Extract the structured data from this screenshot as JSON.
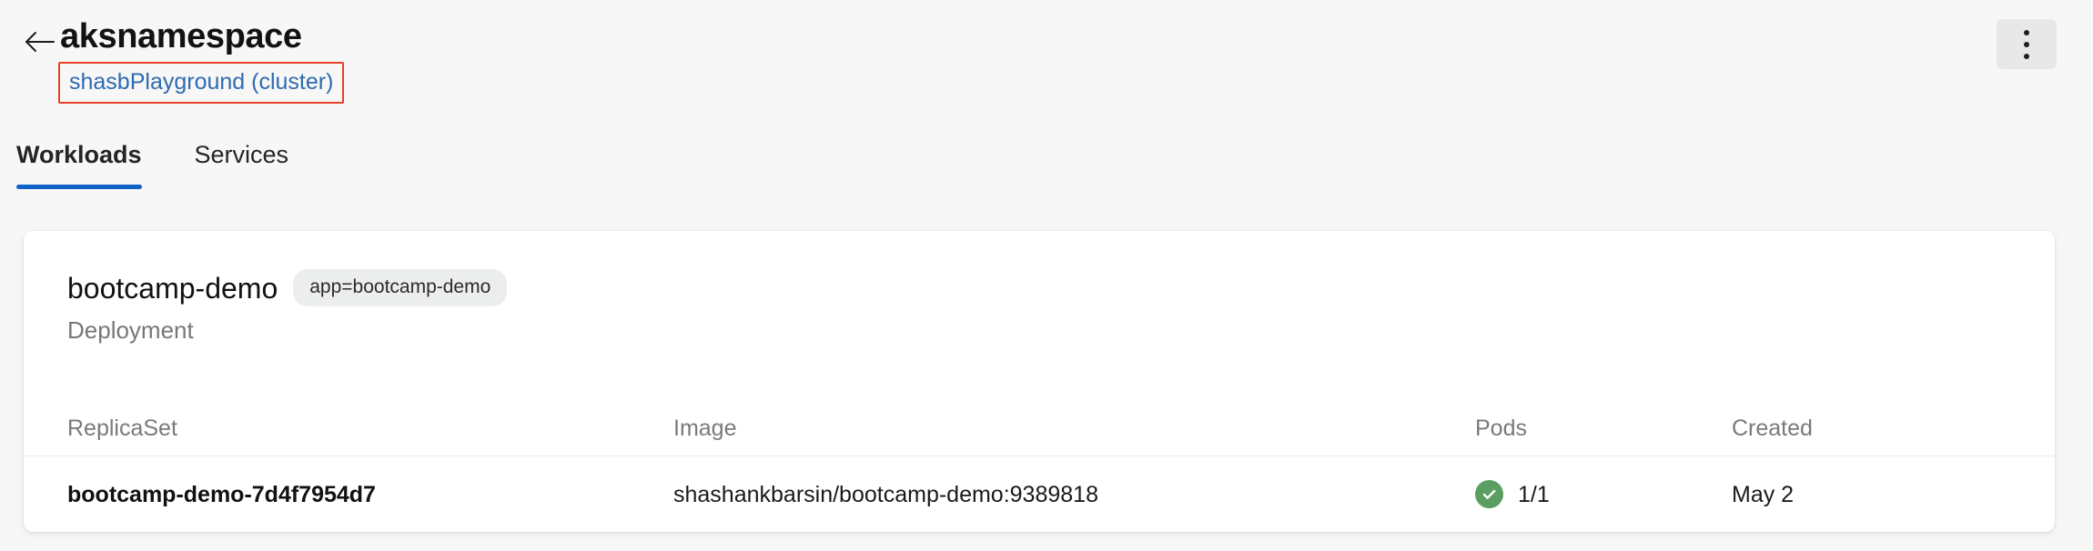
{
  "header": {
    "back_icon": "arrow-left-icon",
    "title": "aksnamespace",
    "cluster_link": "shasbPlayground (cluster)",
    "overflow_icon": "kebab-menu-icon",
    "highlight_color": "#e8402a",
    "link_color": "#2f6bb0"
  },
  "tabs": {
    "items": [
      {
        "label": "Workloads",
        "active": true
      },
      {
        "label": "Services",
        "active": false
      }
    ],
    "accent_color": "#0f62c8",
    "filter_icon": "filter-funnel-icon"
  },
  "card": {
    "title": "bootcamp-demo",
    "label_badge": "app=bootcamp-demo",
    "kind": "Deployment",
    "table": {
      "columns": [
        "ReplicaSet",
        "Image",
        "Pods",
        "Created"
      ],
      "rows": [
        {
          "replicaset": "bootcamp-demo-7d4f7954d7",
          "image": "shashankbarsin/bootcamp-demo:9389818",
          "pods_status_icon": "check-circle-icon",
          "pods_status_color": "#5a9e62",
          "pods": "1/1",
          "created": "May 2"
        }
      ]
    }
  }
}
